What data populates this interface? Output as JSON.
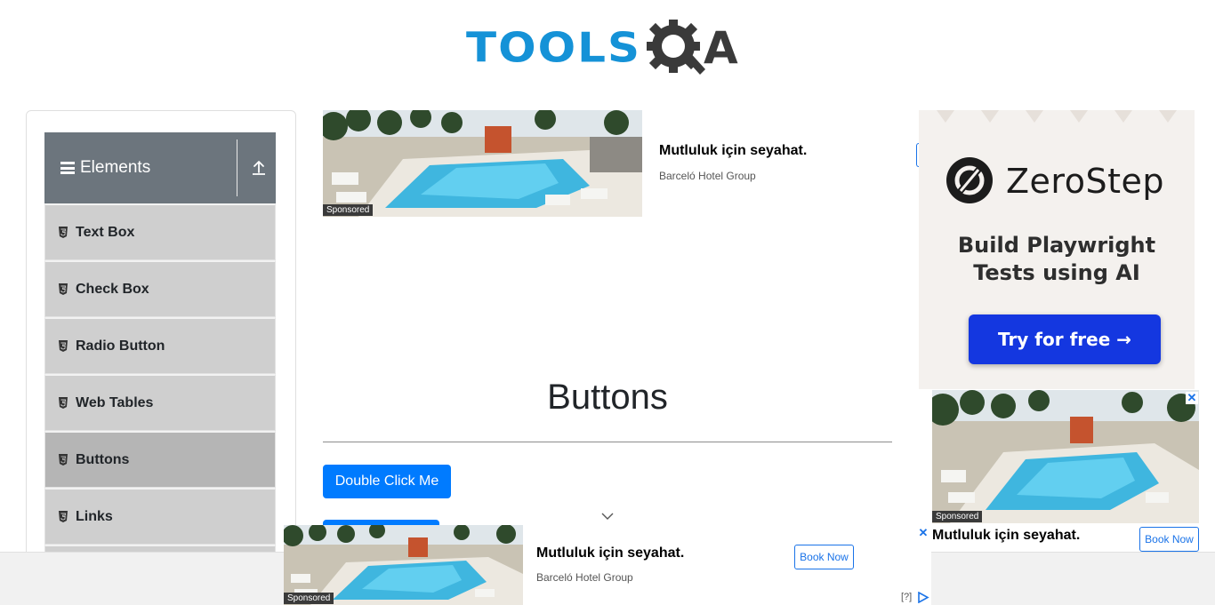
{
  "header": {
    "logo_part1": "TOOLS",
    "logo_part2": "A",
    "logo_brand_color": "#1592d7"
  },
  "sidebar": {
    "group_title": "Elements",
    "items": [
      {
        "label": "Text Box"
      },
      {
        "label": "Check Box"
      },
      {
        "label": "Radio Button"
      },
      {
        "label": "Web Tables"
      },
      {
        "label": "Buttons",
        "active": true
      },
      {
        "label": "Links"
      }
    ]
  },
  "ad_top": {
    "sponsored": "Sponsored",
    "title": "Mutluluk için seyahat.",
    "advertiser": "Barceló Hotel Group"
  },
  "main": {
    "title": "Buttons",
    "double_click_label": "Double Click Me",
    "primary_color": "#007bff"
  },
  "ad_right": {
    "brand": "ZeroStep",
    "tagline": "Build Playwright Tests using AI",
    "cta": "Try for free →",
    "cta_color": "#1437e0"
  },
  "ad_right_hotel": {
    "sponsored": "Sponsored",
    "title": "Mutluluk için seyahat.",
    "button": "Book Now",
    "close": "✕"
  },
  "ad_bottom": {
    "sponsored": "Sponsored",
    "title": "Mutluluk için seyahat.",
    "advertiser": "Barceló Hotel Group",
    "button": "Book Now",
    "close": "✕",
    "adchoices": "[?]"
  }
}
